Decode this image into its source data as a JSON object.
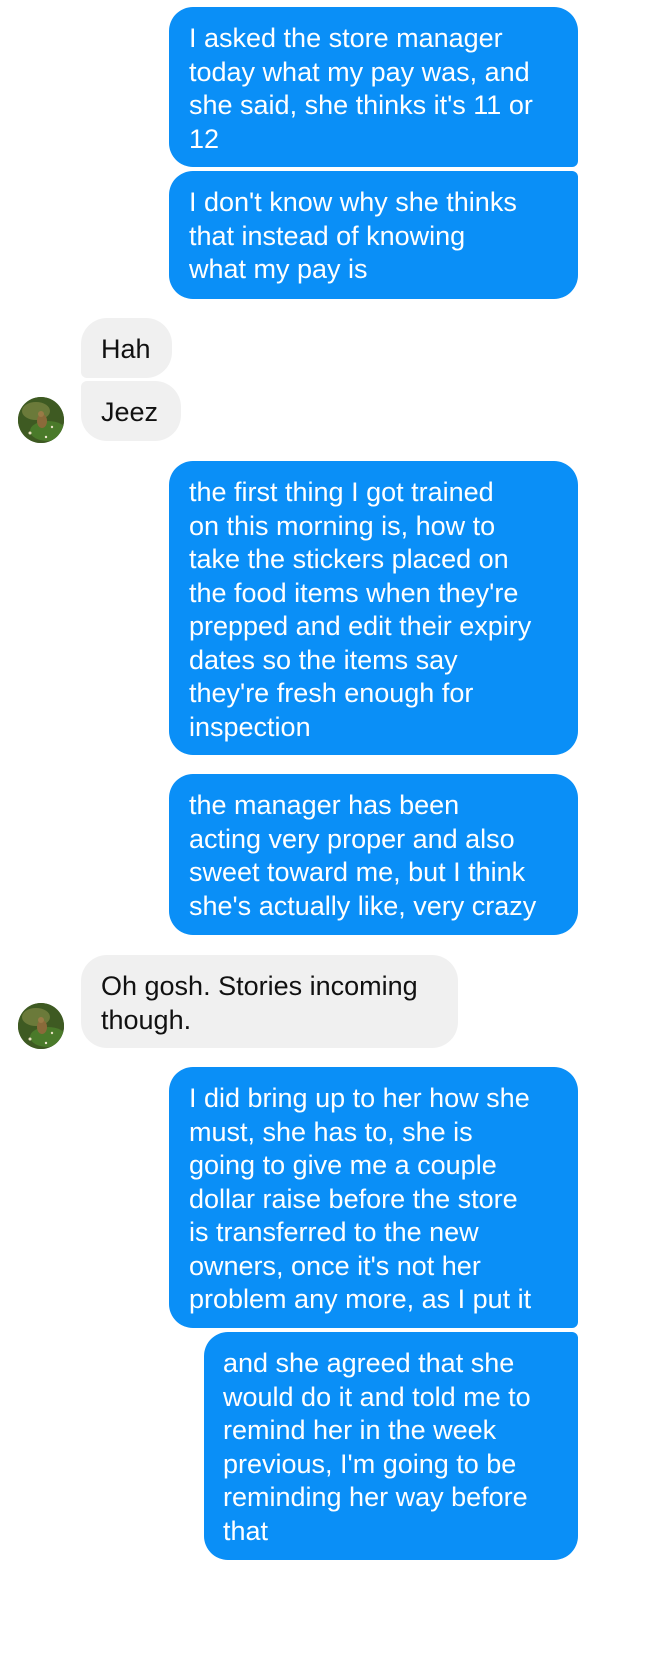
{
  "conversation": {
    "messages": [
      {
        "id": "m1",
        "direction": "outgoing",
        "text": "I asked the store manager\ntoday what my pay was, and\nshe said, she thinks it's 11 or\n12"
      },
      {
        "id": "m2",
        "direction": "outgoing",
        "text": "I don't know why she thinks\nthat instead of knowing\nwhat my pay is"
      },
      {
        "id": "m3",
        "direction": "incoming",
        "text": "Hah"
      },
      {
        "id": "m4",
        "direction": "incoming",
        "text": "Jeez"
      },
      {
        "id": "m5",
        "direction": "outgoing",
        "text": "the first thing I got trained\non this morning is, how to\ntake the stickers placed on\nthe food items when they're\nprepped and edit their expiry\ndates so the items say\nthey're fresh enough for\ninspection"
      },
      {
        "id": "m6",
        "direction": "outgoing",
        "text": "the manager has been\nacting very proper and also\nsweet toward me, but I think\nshe's actually like, very crazy"
      },
      {
        "id": "m7",
        "direction": "incoming",
        "text": "Oh gosh. Stories incoming\nthough."
      },
      {
        "id": "m8",
        "direction": "outgoing",
        "text": "I did bring up to her how she\nmust, she has to, she is\ngoing to give me a couple\ndollar raise before the store\nis transferred to the new\nowners, once it's not her\nproblem any more, as I put it"
      },
      {
        "id": "m9",
        "direction": "outgoing",
        "text": "and she agreed that she\nwould do it and told me to\nremind her in the week\nprevious, I'm going to be\nreminding her way before\nthat"
      }
    ]
  },
  "colors": {
    "outgoing_bubble": "#0a8ff7",
    "incoming_bubble": "#f0f0f0"
  },
  "icons": {
    "contact_avatar": "contact-avatar-photo"
  }
}
